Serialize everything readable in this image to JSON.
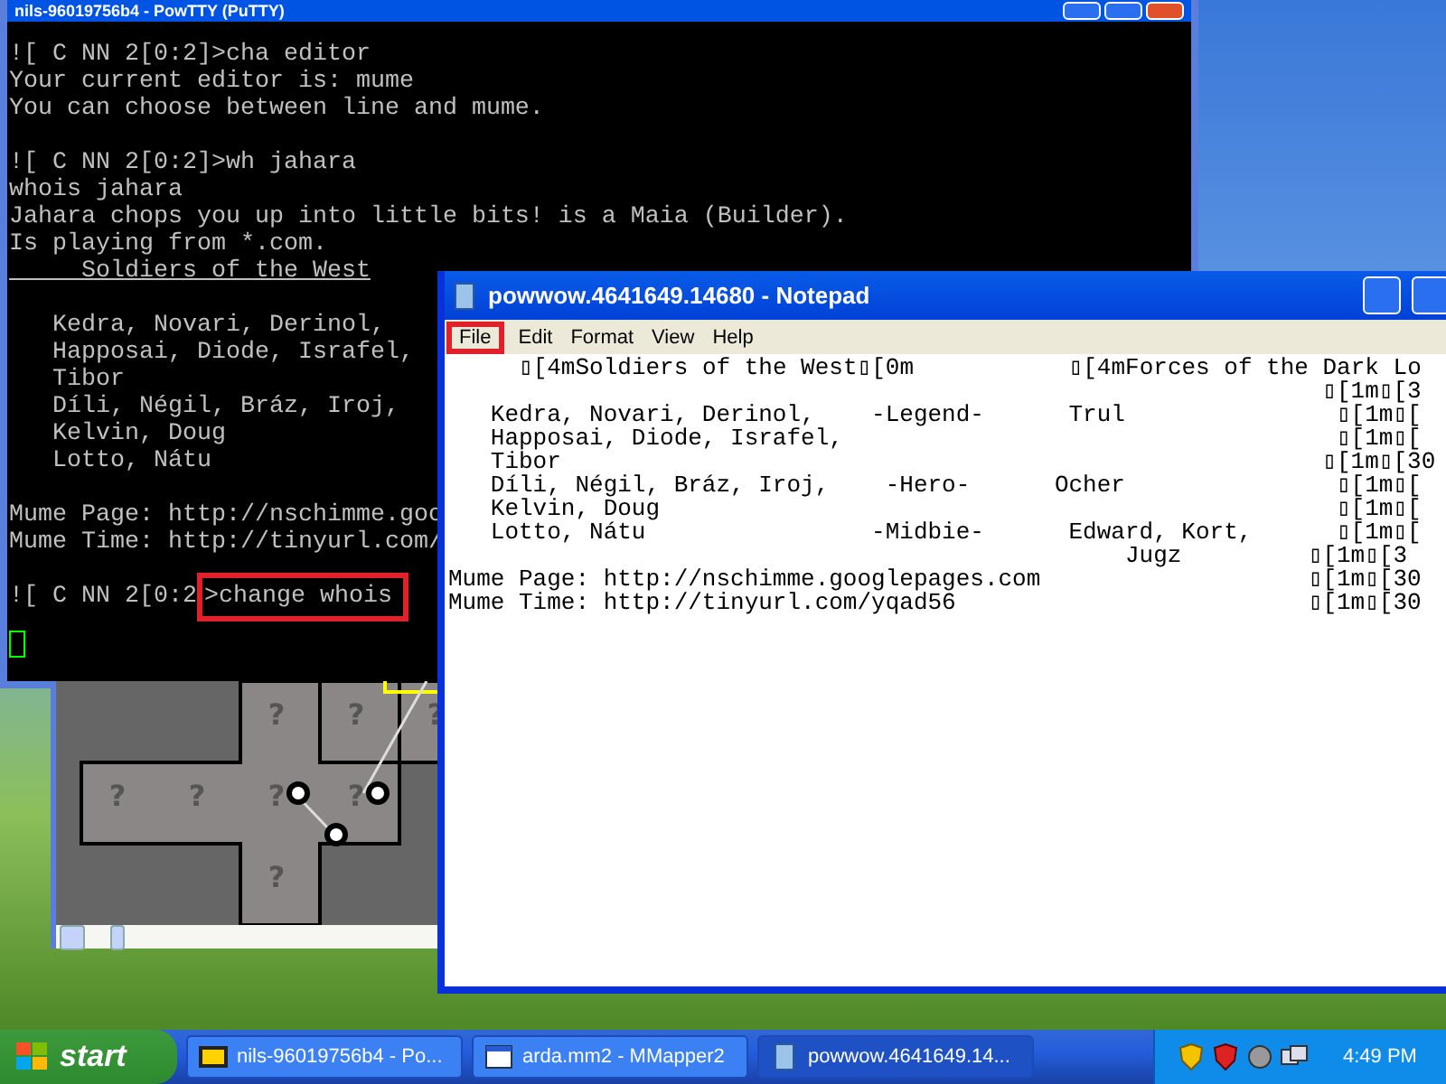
{
  "putty": {
    "title": "nils-96019756b4 - PowTTY (PuTTY)",
    "blocks": [
      [
        {
          "text": "![ C NN 2[0:2]>cha editor",
          "underline": false
        },
        {
          "text": "Your current editor is: mume",
          "underline": false
        },
        {
          "text": "You can choose between line and mume.",
          "underline": false
        }
      ],
      [
        {
          "text": "![ C NN 2[0:2]>wh jahara",
          "underline": false
        },
        {
          "text": "whois jahara",
          "underline": false
        },
        {
          "text": "Jahara chops you up into little bits! is a Maia (Builder).",
          "underline": false
        },
        {
          "text": "Is playing from *.com.",
          "underline": false
        },
        {
          "text": "     Soldiers of the West",
          "underline": true
        }
      ],
      [
        {
          "text": "   Kedra, Novari, Derinol,",
          "underline": false
        },
        {
          "text": "   Happosai, Diode, Israfel,",
          "underline": false
        },
        {
          "text": "   Tibor",
          "underline": false
        },
        {
          "text": "   Díli, Négil, Bráz, Iroj,",
          "underline": false
        },
        {
          "text": "   Kelvin, Doug",
          "underline": false
        },
        {
          "text": "   Lotto, Nátu",
          "underline": false
        }
      ],
      [
        {
          "text": "Mume Page: http://nschimme.goo",
          "underline": false
        },
        {
          "text": "Mume Time: http://tinyurl.com/",
          "underline": false
        }
      ]
    ],
    "prompt": "![ C NN 2[0:2",
    "command": ">change whois"
  },
  "map": {
    "rooms": [
      {
        "label": "?"
      },
      {
        "label": "?"
      },
      {
        "label": "?"
      },
      {
        "label": "?"
      },
      {
        "label": "?"
      },
      {
        "label": "?"
      },
      {
        "label": "?"
      },
      {
        "label": "?"
      }
    ]
  },
  "notepad": {
    "title": "powwow.4641649.14680 - Notepad",
    "menu": [
      {
        "label": "File",
        "highlighted": true
      },
      {
        "label": "Edit",
        "highlighted": false
      },
      {
        "label": "Format",
        "highlighted": false
      },
      {
        "label": "View",
        "highlighted": false
      },
      {
        "label": "Help",
        "highlighted": false
      }
    ],
    "lines": [
      "     ▯[4mSoldiers of the West▯[0m           ▯[4mForces of the Dark Lo",
      "                                                              ▯[1m▯[3",
      "   Kedra, Novari, Derinol,    -Legend-      Trul               ▯[1m▯[",
      "   Happosai, Diode, Israfel,                                   ▯[1m▯[",
      "   Tibor                                                      ▯[1m▯[30",
      "   Díli, Négil, Bráz, Iroj,    -Hero-      Ocher               ▯[1m▯[",
      "   Kelvin, Doug                                                ▯[1m▯[",
      "   Lotto, Nátu                -Midbie-      Edward, Kort,      ▯[1m▯[",
      "                                                Jugz         ▯[1m▯[3",
      "Mume Page: http://nschimme.googlepages.com                   ▯[1m▯[30",
      "Mume Time: http://tinyurl.com/yqad56                         ▯[1m▯[30"
    ]
  },
  "taskbar": {
    "start": "start",
    "tasks": [
      {
        "label": "nils-96019756b4 - Po...",
        "selected": false,
        "kind": "putty"
      },
      {
        "label": "arda.mm2 - MMapper2",
        "selected": false,
        "kind": "window"
      },
      {
        "label": "powwow.4641649.14...",
        "selected": true,
        "kind": "notepad"
      }
    ],
    "clock": "4:49 PM"
  }
}
